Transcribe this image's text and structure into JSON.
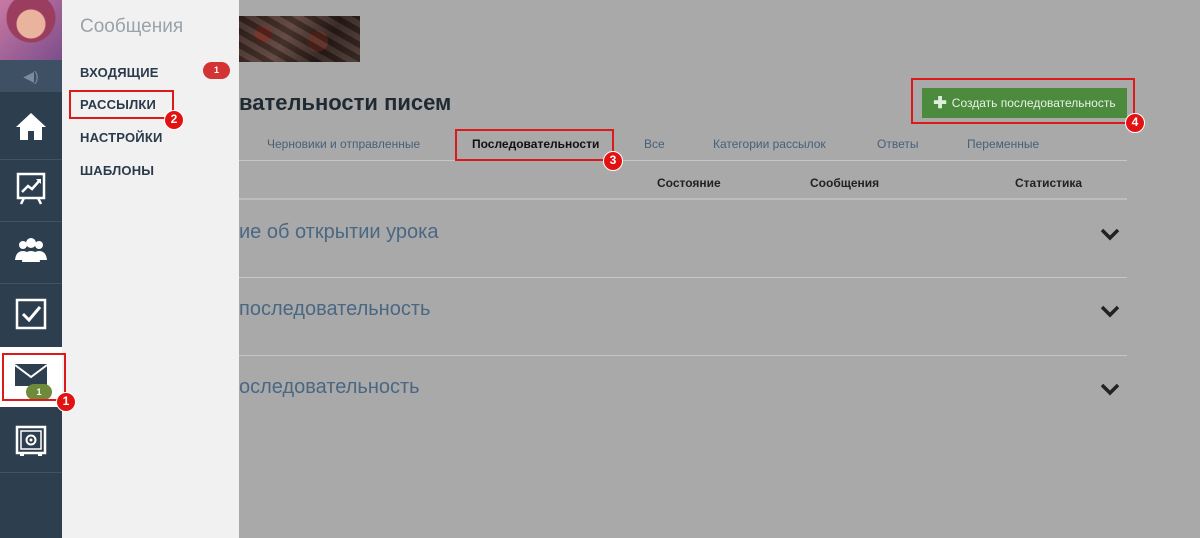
{
  "submenu": {
    "title": "Сообщения",
    "items": [
      {
        "label": "ВХОДЯЩИЕ",
        "badge": "1"
      },
      {
        "label": "РАССЫЛКИ"
      },
      {
        "label": "НАСТРОЙКИ"
      },
      {
        "label": "ШАБЛОНЫ"
      }
    ]
  },
  "rail": {
    "sound_icon": "◀)",
    "items": [
      "home-icon",
      "chart-icon",
      "users-icon",
      "checkbox-icon",
      "mail-icon",
      "safe-icon"
    ],
    "mail_badge": "1"
  },
  "main": {
    "title": "вательности писем",
    "create_button": {
      "plus": "✚",
      "label": "Создать последовательность"
    },
    "tabs": [
      {
        "label": "Черновики и отправленные"
      },
      {
        "label": "Последовательности",
        "active": true
      },
      {
        "label": "Все"
      },
      {
        "label": "Категории рассылок"
      },
      {
        "label": "Ответы"
      },
      {
        "label": "Переменные"
      }
    ],
    "columns": [
      "Состояние",
      "Сообщения",
      "Статистика"
    ],
    "sequences": [
      {
        "title": "ие об открытии урока"
      },
      {
        "title": "последовательность"
      },
      {
        "title": "оследовательность"
      }
    ]
  },
  "annotations": [
    "1",
    "2",
    "3",
    "4"
  ],
  "colors": {
    "rail": "#2d3e4f",
    "accent_green": "#4c8b3e",
    "annotation_red": "#dd1a1a",
    "link_blue": "#4a6784"
  }
}
